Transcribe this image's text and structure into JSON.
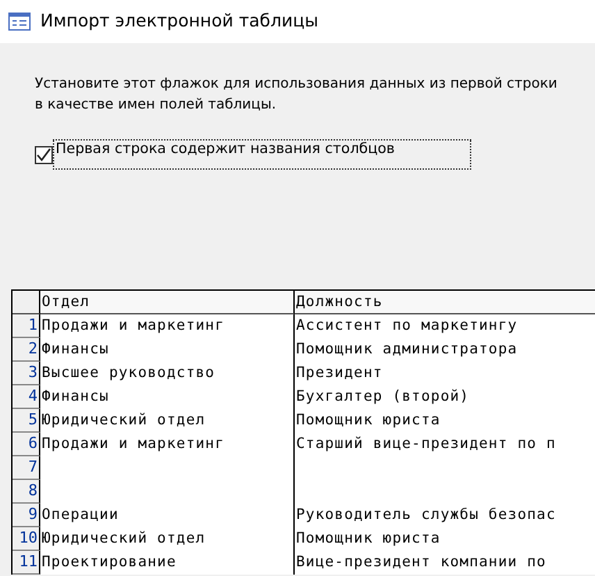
{
  "window": {
    "title": "Импорт электронной таблицы"
  },
  "instruction": "Установите этот флажок для использования данных из первой строки в качестве имен полей таблицы.",
  "checkbox": {
    "label": "Первая строка содержит названия столбцов",
    "checked": true
  },
  "table": {
    "columns": [
      "Отдел",
      "Должность"
    ],
    "rows": [
      {
        "number": "1",
        "cells": [
          "Продажи и маркетинг",
          "Ассистент по маркетингу"
        ]
      },
      {
        "number": "2",
        "cells": [
          "Финансы",
          "Помощник администратора"
        ]
      },
      {
        "number": "3",
        "cells": [
          "Высшее руководство",
          "Президент"
        ]
      },
      {
        "number": "4",
        "cells": [
          "Финансы",
          "Бухгалтер (второй)"
        ]
      },
      {
        "number": "5",
        "cells": [
          "Юридический отдел",
          "Помощник юриста"
        ]
      },
      {
        "number": "6",
        "cells": [
          "Продажи и маркетинг",
          "Старший вице-президент по п"
        ]
      },
      {
        "number": "7",
        "cells": [
          "",
          ""
        ]
      },
      {
        "number": "8",
        "cells": [
          "",
          ""
        ]
      },
      {
        "number": "9",
        "cells": [
          "Операции",
          "Руководитель службы безопас"
        ]
      },
      {
        "number": "10",
        "cells": [
          "Юридический отдел",
          "Помощник юриста"
        ]
      },
      {
        "number": "11",
        "cells": [
          "Проектирование",
          "Вице-президент компании по"
        ]
      }
    ]
  }
}
